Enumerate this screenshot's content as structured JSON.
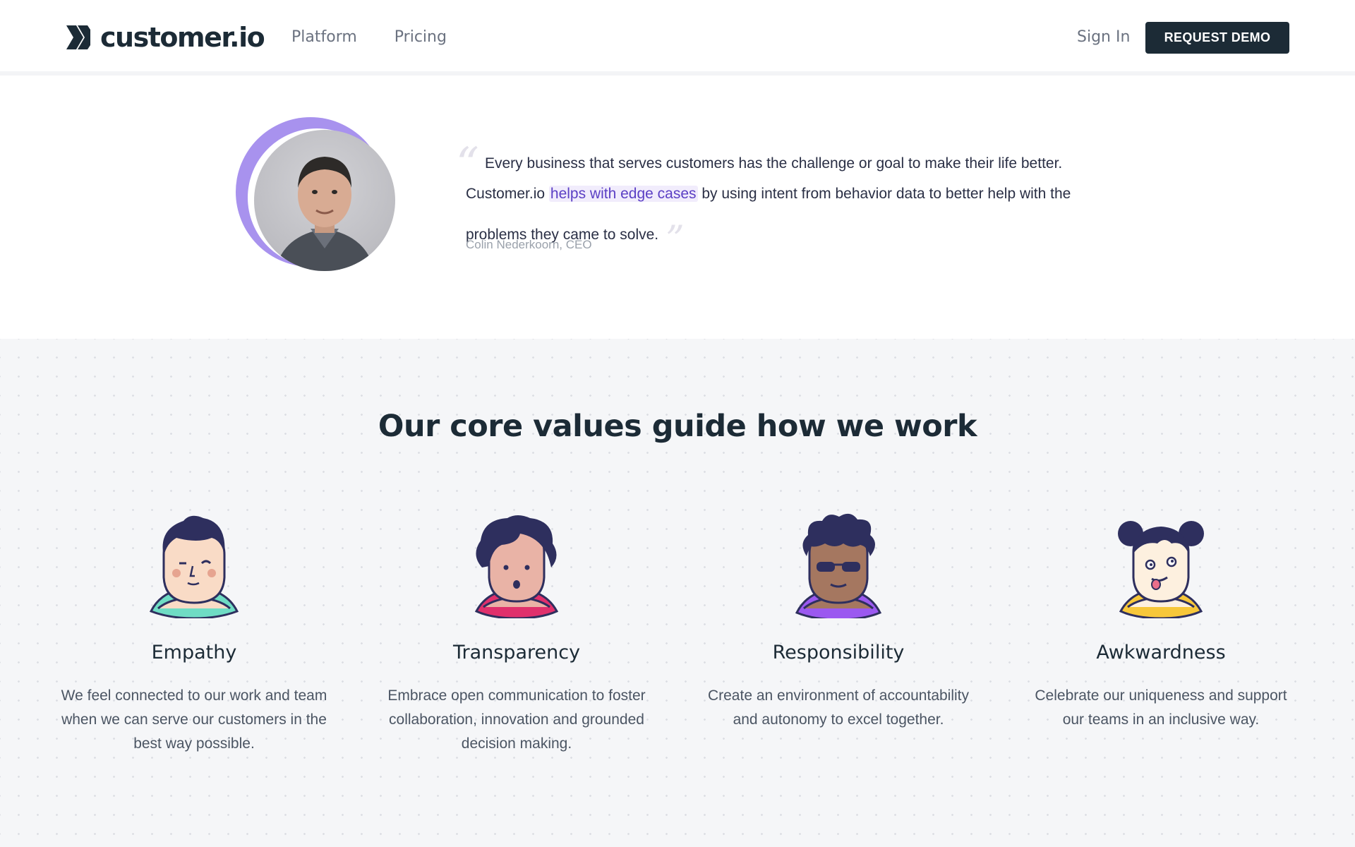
{
  "header": {
    "logo_text": "customer.io",
    "nav": [
      "Platform",
      "Pricing"
    ],
    "sign_in": "Sign In",
    "cta": "REQUEST DEMO"
  },
  "testimonial": {
    "quote_part1": "Every business that serves customers has the challenge or goal to make their life better. Customer.io ",
    "quote_highlight": "helps with edge cases",
    "quote_part2": " by using intent from behavior data to better help with the problems they came to solve.",
    "attribution": "Colin Nederkoorn, CEO"
  },
  "values": {
    "title": "Our core values guide how we work",
    "items": [
      {
        "name": "Empathy",
        "description": "We feel connected to our work and team when we can serve our customers in the best way possible.",
        "icon": "empathy-face-icon",
        "shirt_color": "#6fdcc4"
      },
      {
        "name": "Transparency",
        "description": "Embrace open communication to foster collaboration, innovation and grounded decision making.",
        "icon": "transparency-face-icon",
        "shirt_color": "#e0306c"
      },
      {
        "name": "Responsibility",
        "description": "Create an environment of accountability and autonomy to excel together.",
        "icon": "responsibility-face-icon",
        "shirt_color": "#9b59f0"
      },
      {
        "name": "Awkwardness",
        "description": "Celebrate our uniqueness and support our teams in an inclusive way.",
        "icon": "awkwardness-face-icon",
        "shirt_color": "#f7c73a"
      }
    ]
  },
  "colors": {
    "brand_dark": "#1c2b36",
    "accent_purple": "#a892ee",
    "highlight_text": "#5b3fc4"
  }
}
